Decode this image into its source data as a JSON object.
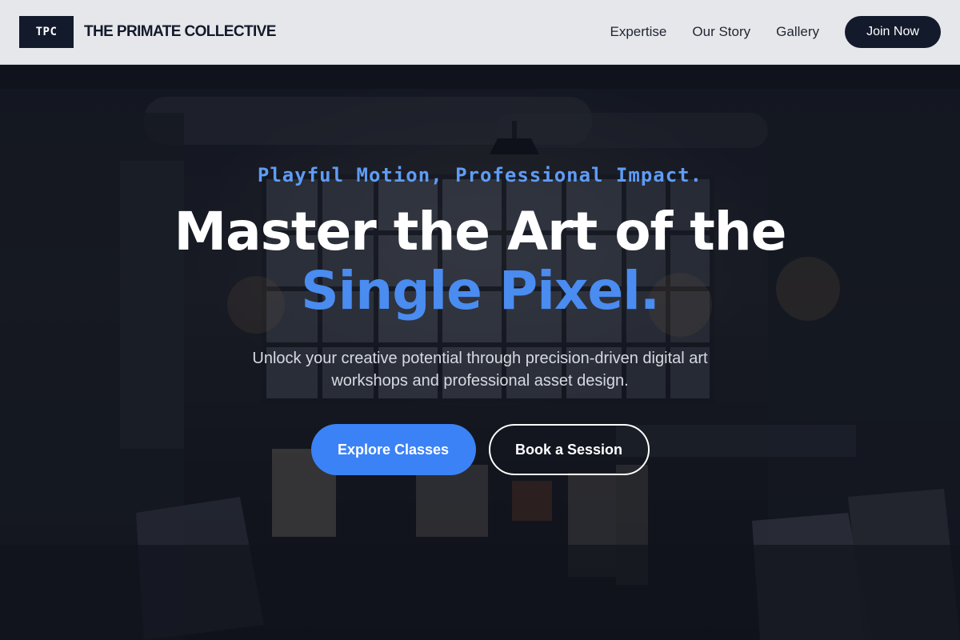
{
  "header": {
    "logo_text": "TPC",
    "brand_name": "THE PRIMATE COLLECTIVE",
    "nav": [
      "Expertise",
      "Our Story",
      "Gallery"
    ],
    "cta_label": "Join Now"
  },
  "hero": {
    "tagline": "Playful Motion, Professional Impact.",
    "headline_line1": "Master the Art of the",
    "headline_line2": "Single Pixel.",
    "subtext": "Unlock your creative potential through precision-driven digital art workshops and professional asset design.",
    "primary_cta": "Explore Classes",
    "secondary_cta": "Book a Session"
  },
  "colors": {
    "header_bg": "#e6e7ea",
    "dark_navy": "#131a2c",
    "accent_blue": "#3b82f6",
    "tagline_blue": "#5f9cf4"
  }
}
